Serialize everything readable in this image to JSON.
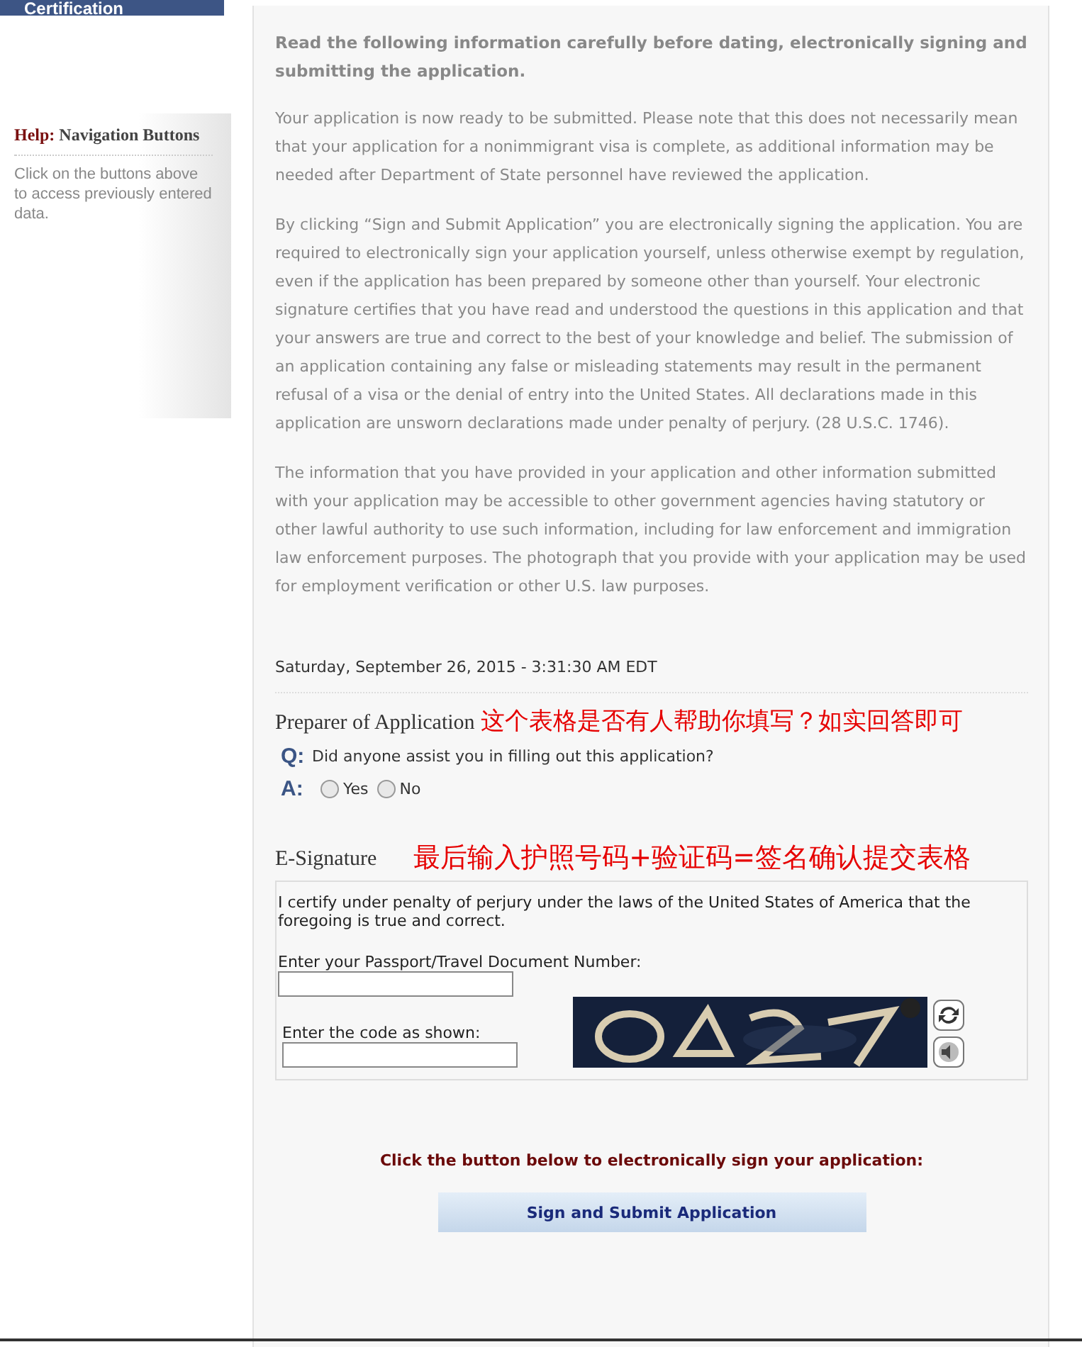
{
  "sidebar": {
    "nav_button": "Certification",
    "help": {
      "title_prefix": "Help:",
      "title": "Navigation Buttons",
      "text": "Click on the buttons above to access previously entered data."
    }
  },
  "main": {
    "heading": "Read the following information carefully before dating, electronically signing and submitting the application.",
    "paragraphs": [
      "Your application is now ready to be submitted. Please note that this does not necessarily mean that your application for a nonimmigrant visa is complete, as additional information may be needed after Department of State personnel have reviewed the application.",
      "By clicking “Sign and Submit Application” you are electronically signing the application. You are required to electronically sign your application yourself, unless otherwise exempt by regulation, even if the application has been prepared by someone other than yourself. Your electronic signature certifies that you have read and understood the questions in this application and that your answers are true and correct to the best of your knowledge and belief. The submission of an application containing any false or misleading statements may result in the permanent refusal of a visa or the denial of entry into the United States. All declarations made in this application are unsworn declarations made under penalty of perjury. (28 U.S.C. 1746).",
      "The information that you have provided in your application and other information submitted with your application may be accessible to other government agencies having statutory or other lawful authority to use such information, including for law enforcement and immigration law enforcement purposes. The photograph that you provide with your application may be used for employment verification or other U.S. law purposes."
    ],
    "timestamp": "Saturday, September 26, 2015 - 3:31:30 AM EDT",
    "preparer": {
      "title": "Preparer of Application",
      "annotation": "这个表格是否有人帮助你填写？如实回答即可",
      "q_label": "Q:",
      "question": "Did anyone assist you in filling out this application?",
      "a_label": "A:",
      "options": [
        {
          "label": "Yes",
          "selected": false
        },
        {
          "label": "No",
          "selected": false
        }
      ]
    },
    "esignature": {
      "title": "E-Signature",
      "annotation": "最后输入护照号码+验证码=签名确认提交表格",
      "certify": "I certify under penalty of perjury under the laws of the United States of America that the foregoing is true and correct.",
      "passport_label": "Enter your Passport/Travel Document Number:",
      "code_label": "Enter the code as shown:"
    },
    "submit_prompt": "Click the button below to electronically sign your application:",
    "submit_button": "Sign and Submit Application"
  }
}
